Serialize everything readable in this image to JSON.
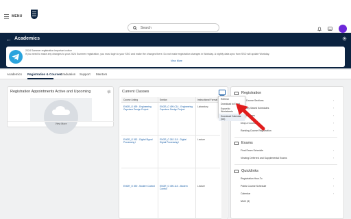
{
  "topbar": {
    "menu_label": "MENU",
    "search_placeholder": "Search"
  },
  "header": {
    "title": "Academics",
    "announcement": {
      "line1": "2024 Summer registration important notice",
      "line2": "If you need to make any changes to your 2024 Summer registration, you must login to your SSO and make the changes there. Do not make registration changes in Workday. A nightly data sync from SSO will update Workday.",
      "more": "View More"
    }
  },
  "tabs": [
    "Academics",
    "Registration & Courses",
    "Graduation",
    "Support",
    "Mentors"
  ],
  "appointments": {
    "title": "Registration Appointments Active and Upcoming",
    "view_more": "View More"
  },
  "classes": {
    "title": "Current Classes",
    "columns": [
      "Course Listing",
      "Section",
      "Instructional Format"
    ],
    "rows": [
      {
        "course": "ENGR_O 499 - Engineering Capstone Design Project",
        "section": "ENGR_O 499-C14 - Engineering Capstone Design Project",
        "format": "Laboratory"
      },
      {
        "course": "ENGR_O 262 - Digital Signal Processing I",
        "section": "ENGR_O 262-110 - Digital Signal Processing I",
        "format": "Lecture"
      },
      {
        "course": "ENGR_O 490 - Modern Control",
        "section": "ENGR_O 490-110 - Modern Control",
        "format": "Lecture"
      }
    ]
  },
  "dropdown": {
    "items": [
      "Refresh",
      "Download to Excel",
      "Export to Worksheets",
      "Download Calendar (ics)"
    ]
  },
  "registration": {
    "title": "Registration",
    "links": [
      "Find Course Sections",
      "View My Saved Schedules",
      "Find Courses",
      "Drop a Course",
      "Ranking Course Registration"
    ]
  },
  "exams": {
    "title": "Exams",
    "links": [
      "Final Exam Schedule",
      "Viewing Deferred and Supplemental Exams"
    ]
  },
  "quicklinks": {
    "title": "Quicklinks",
    "links": [
      "Registration How-To",
      "Public Course Schedule",
      "Calendar",
      "More (3)"
    ]
  },
  "colors": {
    "header_bg": "#0b2340",
    "accent": "#1a5fa8",
    "avatar": "#6d28d9",
    "arrow": "#e11d1d"
  }
}
